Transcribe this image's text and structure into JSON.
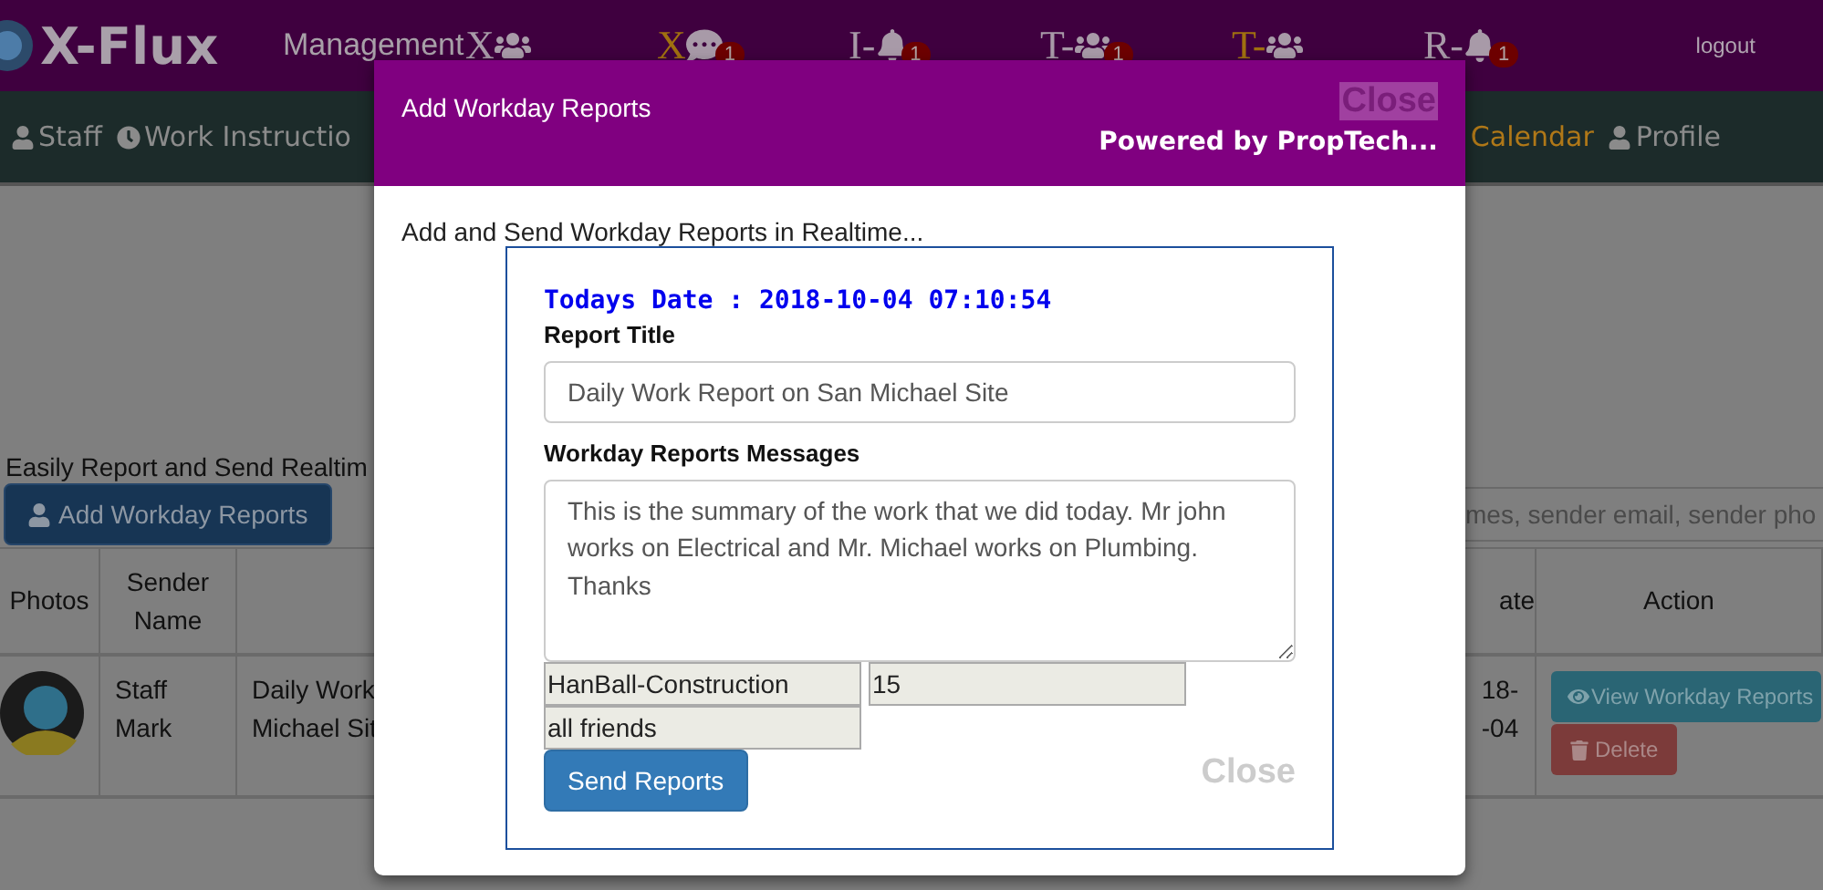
{
  "topbar": {
    "logo": "X-Flux",
    "title": "Management",
    "nav": [
      {
        "prefix": "X",
        "kind": "people",
        "highlighted": false
      },
      {
        "prefix": "X",
        "kind": "chat",
        "highlighted": true,
        "badge": "1"
      },
      {
        "prefix": "I-",
        "kind": "bell",
        "highlighted": false,
        "badge": "1"
      },
      {
        "prefix": "T-",
        "kind": "people",
        "highlighted": false,
        "badge": "1"
      },
      {
        "prefix": "T-",
        "kind": "people",
        "highlighted": true
      },
      {
        "prefix": "R-",
        "kind": "bell",
        "highlighted": false,
        "badge": "1"
      }
    ],
    "logout": "logout"
  },
  "menu_left": [
    {
      "label": "Staff",
      "kind": "user",
      "highlighted": false
    },
    {
      "label": "Work Instructio",
      "kind": "clock",
      "highlighted": false
    }
  ],
  "menu_right": [
    {
      "label": "Calendar",
      "kind": "plain",
      "highlighted": true
    },
    {
      "label": "Profile",
      "kind": "user",
      "highlighted": false
    }
  ],
  "page": {
    "intro": "Easily Report and Send Realtim",
    "add_button": "Add Workday Reports",
    "search": {
      "placeholder": "mes, sender email, sender pho"
    }
  },
  "table": {
    "columns": [
      "Photos",
      "Sender Name",
      "ate",
      "Action"
    ],
    "rows": [
      {
        "sender": "Staff Mark",
        "column_3": [
          "Daily Work",
          "Michael Sit"
        ],
        "date": "18- -04",
        "view_button": "View Workday Reports",
        "delete_button": "Delete"
      }
    ]
  },
  "modal": {
    "title": "Add Workday Reports",
    "close": "Close",
    "powered": "Powered by PropTech...",
    "subtitle": "Add and Send Workday Reports in Realtime...",
    "date": "Todays Date : 2018-10-04 07:10:54",
    "report_title_label": "Report Title",
    "report_title": "Daily Work Report on San Michael Site",
    "messages_label": "Workday Reports Messages",
    "message": "This is the summary of the work that we did today. Mr john works on Electrical and Mr. Michael works on Plumbing. Thanks",
    "readonly_fields": [
      "HanBall-Construction",
      "15",
      "all friends"
    ],
    "send_button": "Send Reports",
    "footer_close": "Close"
  }
}
